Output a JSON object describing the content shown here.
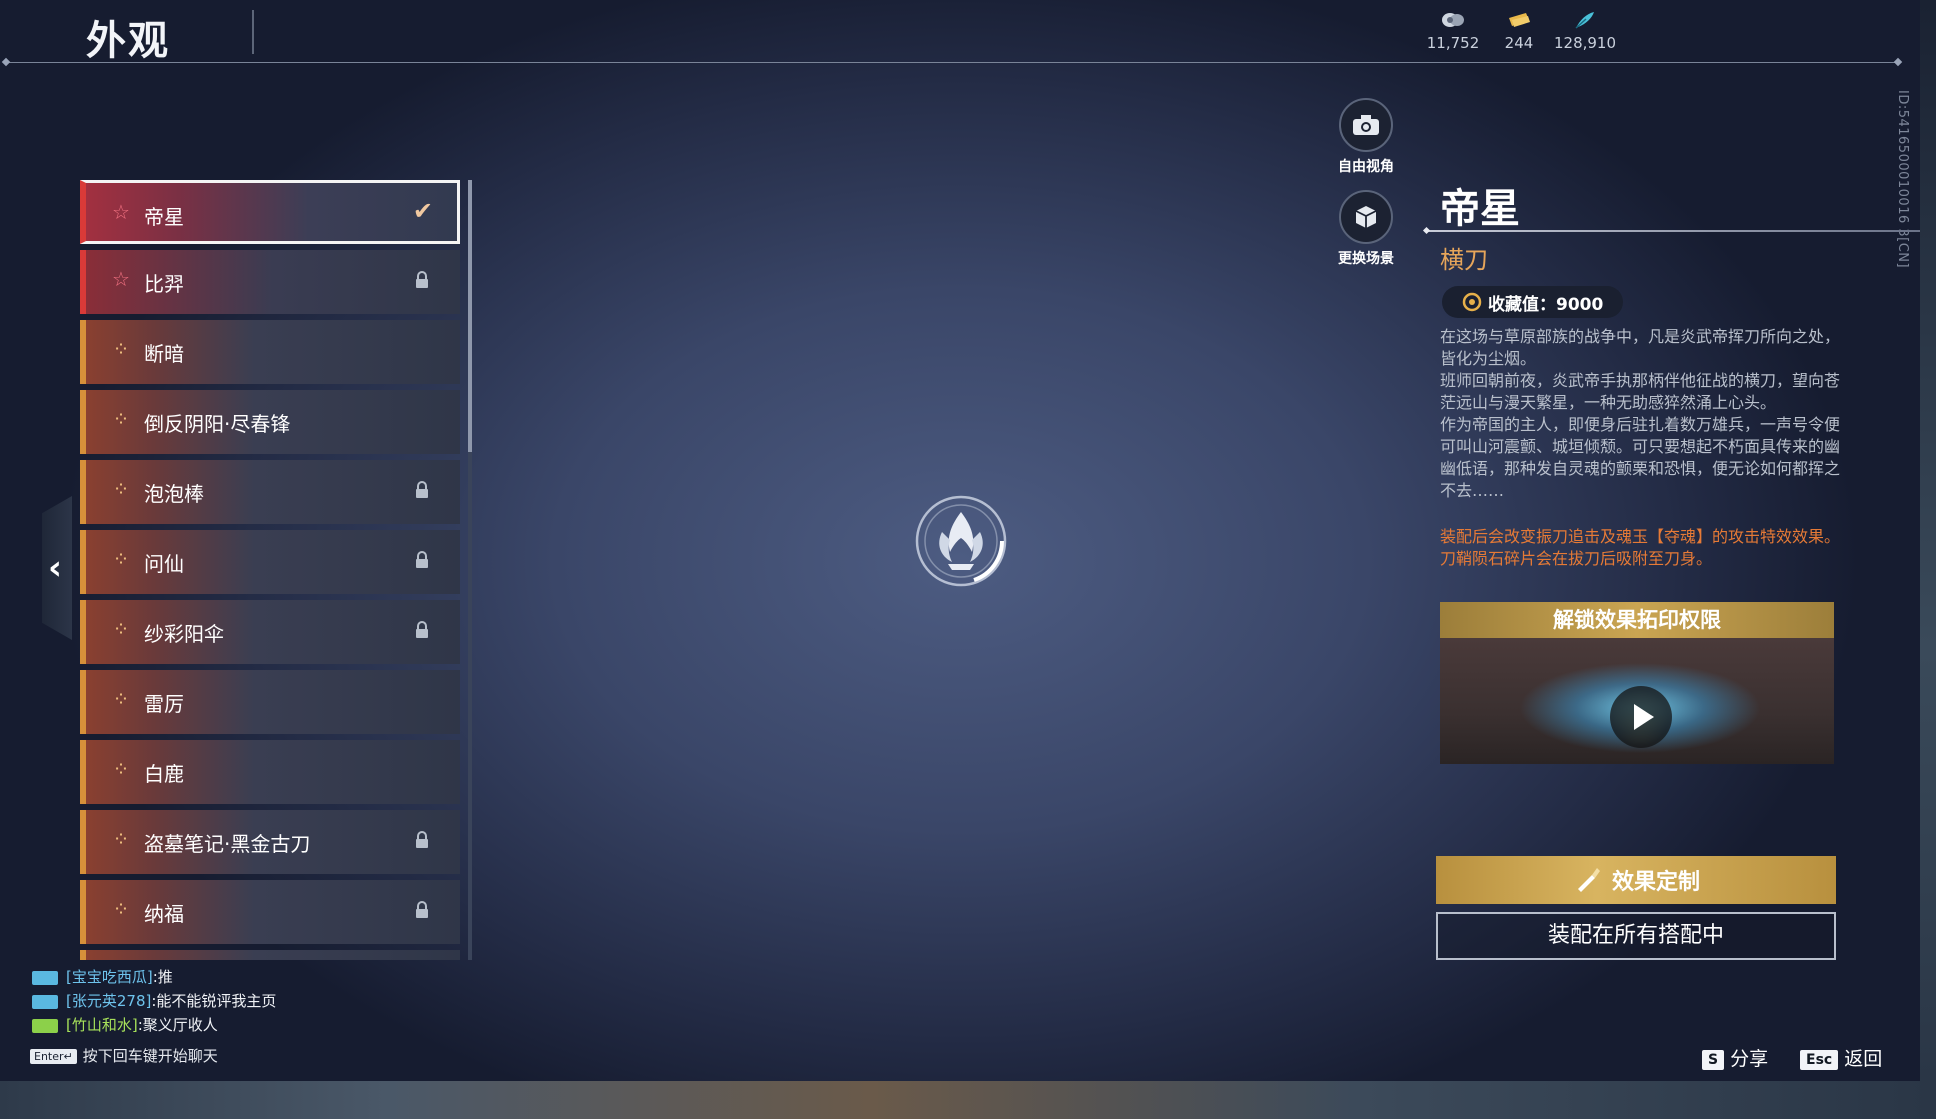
{
  "header": {
    "title": "外观",
    "currencies": [
      {
        "icon": "coin-icon",
        "value": "11,752"
      },
      {
        "icon": "gold-ticket-icon",
        "value": "244"
      },
      {
        "icon": "feather-icon",
        "value": "128,910"
      }
    ]
  },
  "player_id": "ID:5416500010016 3[CN]",
  "list": {
    "items": [
      {
        "label": "帝星",
        "state": "selected"
      },
      {
        "label": "比羿",
        "state": "locked"
      },
      {
        "label": "断暗",
        "state": "normal"
      },
      {
        "label": "倒反阴阳·尽春锋",
        "state": "normal"
      },
      {
        "label": "泡泡棒",
        "state": "locked"
      },
      {
        "label": "问仙",
        "state": "locked"
      },
      {
        "label": "纱彩阳伞",
        "state": "locked"
      },
      {
        "label": "雷厉",
        "state": "normal"
      },
      {
        "label": "白鹿",
        "state": "normal"
      },
      {
        "label": "盗墓笔记·黑金古刀",
        "state": "locked"
      },
      {
        "label": "纳福",
        "state": "locked"
      }
    ]
  },
  "side_buttons": {
    "free_view": "自由视角",
    "change_scene": "更换场景"
  },
  "detail": {
    "name": "帝星",
    "type": "横刀",
    "collection_label": "收藏值：9000",
    "description": [
      "在这场与草原部族的战争中，凡是炎武帝挥刀所向之处，皆化为尘烟。",
      "班师回朝前夜，炎武帝手执那柄伴他征战的横刀，望向苍茫远山与漫天繁星，一种无助感猝然涌上心头。",
      "作为帝国的主人，即便身后驻扎着数万雄兵，一声号令便可叫山河震颤、城垣倾颓。可只要想起不朽面具传来的幽幽低语，那种发自灵魂的颤栗和恐惧，便无论如何都挥之不去……"
    ],
    "effect_notes": [
      "装配后会改变振刀追击及魂玉【夺魂】的攻击特效效果。",
      "刀鞘陨石碎片会在拔刀后吸附至刀身。"
    ],
    "preview_header": "解锁效果拓印权限",
    "custom_button": "效果定制",
    "equip_button": "装配在所有搭配中"
  },
  "chat": {
    "lines": [
      {
        "name": "[宝宝吃西瓜]",
        "msg": ":推",
        "badge_color": "#5ab8e0"
      },
      {
        "name": "[张元英278]",
        "msg": ":能不能锐评我主页",
        "badge_color": "#5ab8e0"
      },
      {
        "name": "[竹山和水]",
        "msg": ":聚义厅收人",
        "badge_color": "#8cd04a"
      }
    ],
    "enter_key": "Enter↵",
    "enter_hint": "按下回车键开始聊天"
  },
  "hotkeys": {
    "share_key": "S",
    "share_label": "分享",
    "back_key": "Esc",
    "back_label": "返回"
  }
}
